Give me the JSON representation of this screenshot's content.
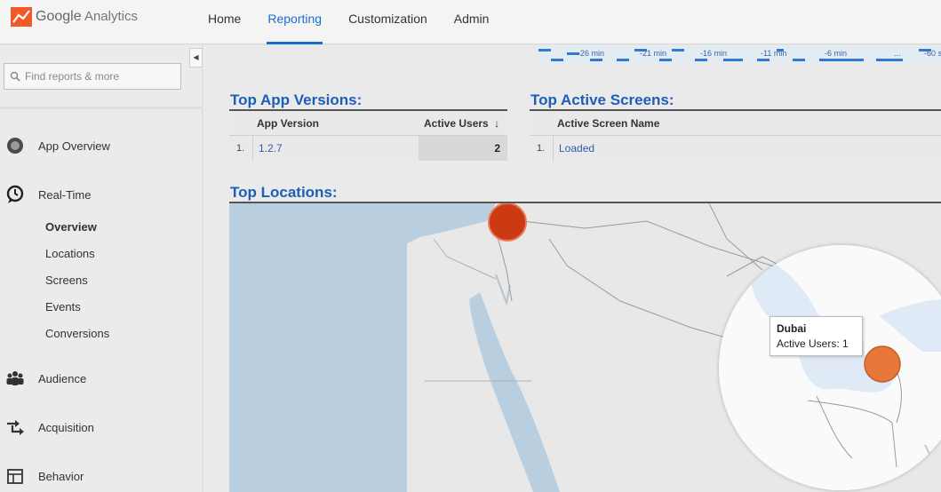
{
  "brand": {
    "logo_google": "Google",
    "logo_analytics": "Analytics"
  },
  "nav": [
    {
      "label": "Home",
      "active": false
    },
    {
      "label": "Reporting",
      "active": true
    },
    {
      "label": "Customization",
      "active": false
    },
    {
      "label": "Admin",
      "active": false
    }
  ],
  "sidebar": {
    "collapse_glyph": "◀",
    "search_placeholder": "Find reports & more",
    "items": [
      {
        "label": "App Overview",
        "icon": "circle-icon"
      },
      {
        "label": "Real-Time",
        "icon": "clock-icon"
      },
      {
        "label": "Audience",
        "icon": "people-icon"
      },
      {
        "label": "Acquisition",
        "icon": "arrows-icon"
      },
      {
        "label": "Behavior",
        "icon": "layout-icon"
      }
    ],
    "realtime_sub": [
      "Overview",
      "Locations",
      "Screens",
      "Events",
      "Conversions"
    ],
    "current_sub": "Overview"
  },
  "timeline": {
    "labels": [
      "-26 min",
      "-21 min",
      "-16 min",
      "-11 min",
      "-6 min",
      "...",
      "-60 s"
    ]
  },
  "app_versions": {
    "title": "Top App Versions:",
    "col_version": "App Version",
    "col_users": "Active Users",
    "sort_glyph": "↓",
    "rows": [
      {
        "index": "1.",
        "version": "1.2.7",
        "users": "2"
      }
    ]
  },
  "active_screens": {
    "title": "Top Active Screens:",
    "col_name": "Active Screen Name",
    "rows": [
      {
        "index": "1.",
        "name": "Loaded"
      }
    ]
  },
  "locations": {
    "title": "Top Locations:"
  },
  "tooltip": {
    "city": "Dubai",
    "label": "Active Users:",
    "value": "1"
  },
  "colors": {
    "accent": "#1a6ed0",
    "marker_red": "#cc3a14",
    "marker_orange": "#e8773a",
    "water": "#c7dff2"
  }
}
